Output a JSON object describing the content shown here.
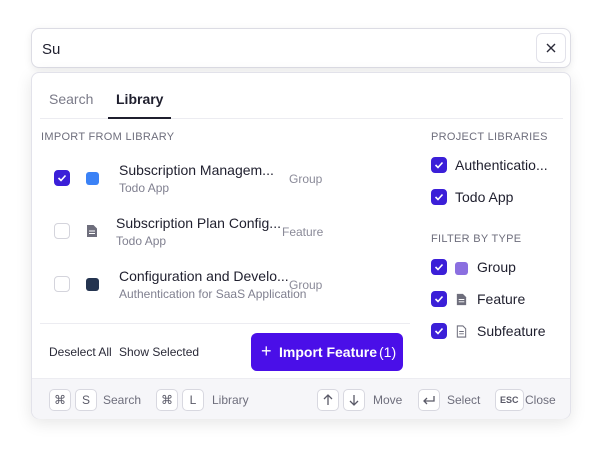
{
  "search": {
    "value": "Su"
  },
  "tabs": [
    {
      "label": "Search"
    },
    {
      "label": "Library"
    }
  ],
  "import_section": {
    "title": "IMPORT FROM LIBRARY",
    "items": [
      {
        "title": "Subscription Managem...",
        "subtitle": "Todo App",
        "type": "Group",
        "checked": true,
        "swatch": "#3b82f6"
      },
      {
        "title": "Subscription Plan Config...",
        "subtitle": "Todo App",
        "type": "Feature",
        "checked": false
      },
      {
        "title": "Configuration and Develo...",
        "subtitle": "Authentication for SaaS Application",
        "type": "Group",
        "checked": false,
        "swatch": "#243450"
      }
    ]
  },
  "actions": {
    "deselect_all": "Deselect All",
    "show_selected": "Show Selected",
    "import_label": "Import Feature",
    "import_count": "(1)"
  },
  "project_libraries": {
    "title": "PROJECT LIBRARIES",
    "items": [
      {
        "label": "Authenticatio..."
      },
      {
        "label": "Todo App"
      }
    ]
  },
  "filter_by_type": {
    "title": "FILTER BY TYPE",
    "items": [
      {
        "label": "Group",
        "swatch": "#8b6fe0"
      },
      {
        "label": "Feature"
      },
      {
        "label": "Subfeature"
      }
    ]
  },
  "footer": {
    "search_key": "S",
    "search_label": "Search",
    "library_key": "L",
    "library_label": "Library",
    "move_label": "Move",
    "select_label": "Select",
    "close_key": "ESC",
    "close_label": "Close"
  },
  "colors": {
    "accent": "#4a0fe8",
    "check": "#3b1fd8"
  }
}
